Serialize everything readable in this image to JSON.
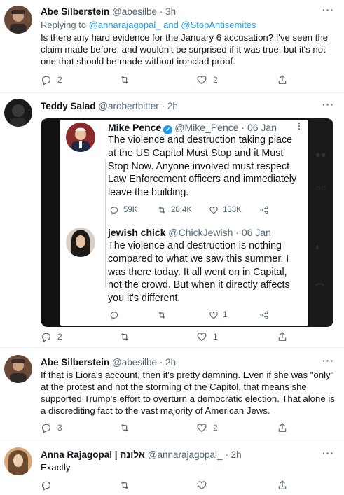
{
  "tweets": [
    {
      "name": "Abe Silberstein",
      "handle": "@abesilbe",
      "time": "3h",
      "reply_prefix": "Replying to",
      "reply_to": "@annarajagopal_ and @StopAntisemites",
      "text": "Is there any hard evidence for the January 6 accusation? I've seen the claim made before, and wouldn't be surprised if it was true, but it's not one that should be made without ironclad proof.",
      "replies": "2",
      "retweets": "",
      "likes": "2"
    },
    {
      "name": "Teddy Salad",
      "handle": "@arobertbitter",
      "time": "2h",
      "replies": "2",
      "retweets": "",
      "likes": "1"
    },
    {
      "name": "Abe Silberstein",
      "handle": "@abesilbe",
      "time": "2h",
      "text": "If that is Liora's account, then it's pretty damning. Even if she was \"only\" at the protest and not the storming of the Capitol, that means she supported Trump's effort to overturn a democratic election. That alone is a discrediting fact to the vast majority of American Jews.",
      "replies": "3",
      "retweets": "",
      "likes": "2"
    },
    {
      "name": "Anna Rajagopal | אלונה",
      "handle": "@annarajagopal_",
      "time": "2h",
      "text": "Exactly.",
      "replies": "",
      "retweets": "",
      "likes": ""
    }
  ],
  "embedded": {
    "quote1": {
      "name": "Mike Pence",
      "handle": "@Mike_Pence · 06 Jan",
      "text": "The violence and destruction taking place at the US Capitol Must Stop and it Must Stop Now. Anyone involved must respect Law Enforcement officers and immediately leave the building.",
      "replies": "59K",
      "retweets": "28.4K",
      "likes": "133K"
    },
    "quote2": {
      "name": "jewish chick",
      "handle": "@ChickJewish · 06 Jan",
      "text": "The violence and destruction is nothing compared to what we saw this summer. I was there today. It all went on in Capital, not the crowd. But when it directly affects you it's different.",
      "replies": "",
      "retweets": "",
      "likes": "1"
    }
  },
  "sep": "·",
  "icons": [
    "reply-icon",
    "retweet-icon",
    "like-icon",
    "share-icon",
    "more-icon",
    "verified-icon"
  ],
  "colors": {
    "link": "#1d9bf0",
    "muted": "#536471",
    "divider": "#eff3f4"
  }
}
